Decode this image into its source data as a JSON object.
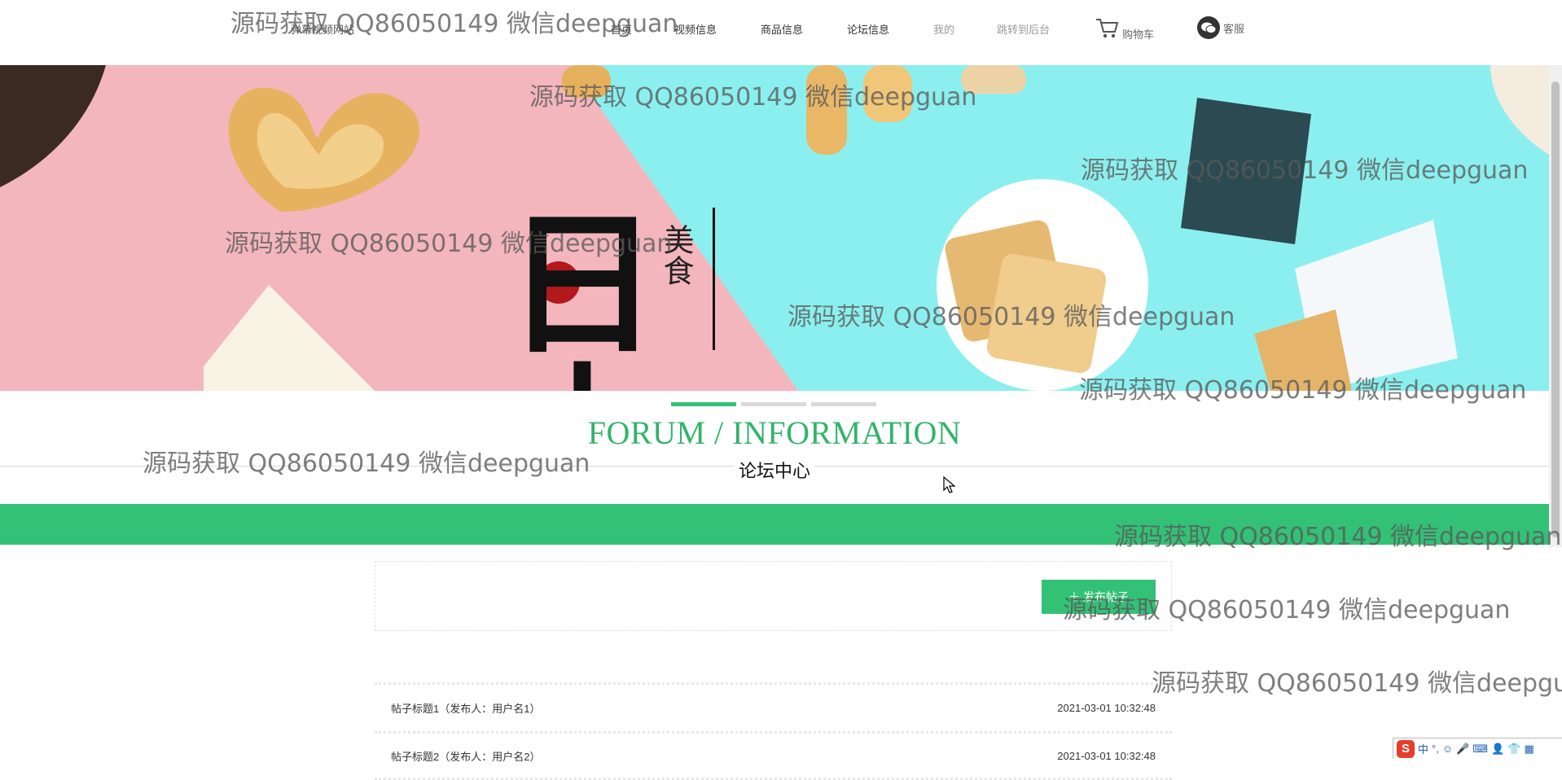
{
  "header": {
    "site_title": "弹幕视频网站",
    "nav": [
      {
        "label": "首页",
        "muted": false
      },
      {
        "label": "视频信息",
        "muted": false
      },
      {
        "label": "商品信息",
        "muted": false
      },
      {
        "label": "论坛信息",
        "muted": false
      },
      {
        "label": "我的",
        "muted": true
      },
      {
        "label": "跳转到后台",
        "muted": true
      }
    ],
    "cart_label": "购物车",
    "service_label": "客服"
  },
  "banner": {
    "big_character": "日本",
    "small_characters": "美食",
    "slide_count": 3,
    "active_slide": 0
  },
  "section": {
    "title_en": "FORUM / INFORMATION",
    "title_cn": "论坛中心"
  },
  "forum": {
    "publish_button": "＋ 发布帖子",
    "posts": [
      {
        "title": "帖子标题1（发布人：用户名1）",
        "time": "2021-03-01 10:32:48"
      },
      {
        "title": "帖子标题2（发布人：用户名2）",
        "time": "2021-03-01 10:32:48"
      }
    ]
  },
  "ime": {
    "logo": "S",
    "mode": "中"
  },
  "watermark_text": "源码获取 QQ86050149 微信deepguan",
  "colors": {
    "accent_green": "#33c176",
    "heading_green": "#33b36a",
    "banner_pink": "#f4b6bd",
    "banner_cyan": "#8cefef"
  }
}
